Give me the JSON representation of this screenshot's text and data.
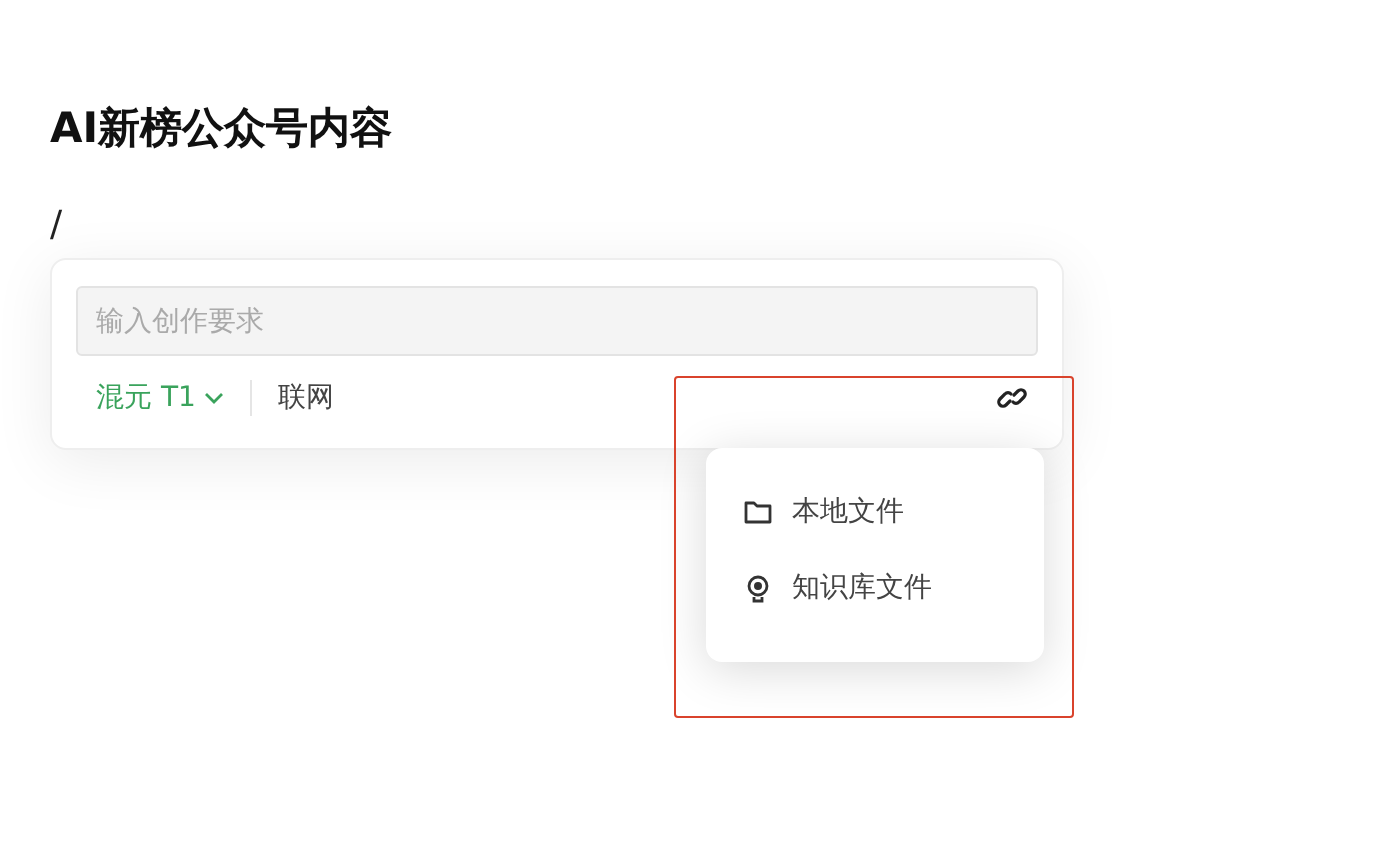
{
  "title": "AI新榜公众号内容",
  "slash": "/",
  "composer": {
    "placeholder": "输入创作要求",
    "model": "混元 T1",
    "web_search": "联网"
  },
  "attach_menu": {
    "items": [
      {
        "kind": "folder",
        "label": "本地文件"
      },
      {
        "kind": "bulb",
        "label": "知识库文件"
      }
    ]
  },
  "highlight": true
}
